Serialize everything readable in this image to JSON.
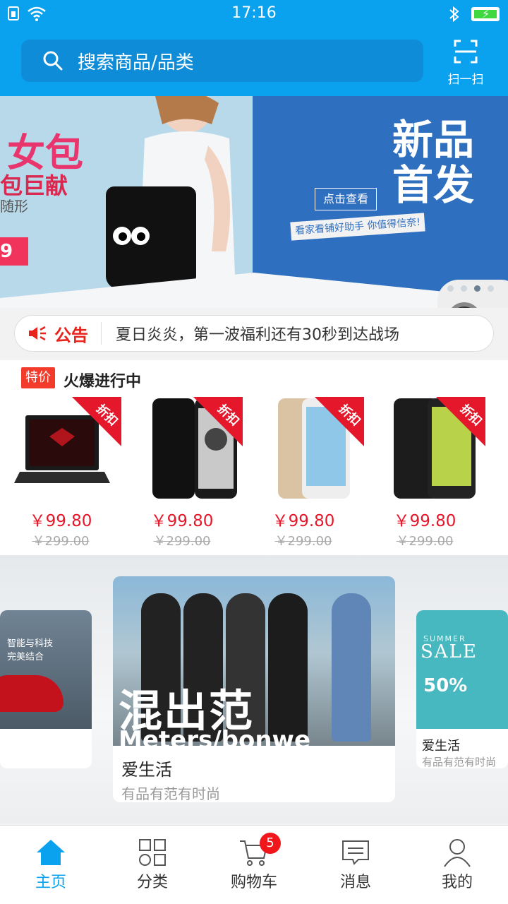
{
  "status_bar": {
    "time": "17:16"
  },
  "header": {
    "search_placeholder": "搜索商品/品类",
    "scan_label": "扫一扫"
  },
  "banner": {
    "left_title": "女包",
    "left_subtitle": "包巨献",
    "left_small": "随形",
    "left_price": "9",
    "view_button": "点击查看",
    "slogan": "看家看铺好助手 你值得信奈!",
    "right_title": "新品首发",
    "dots": 4,
    "active_dot": 3
  },
  "notice": {
    "title": "公告",
    "text": "夏日炎炎，第一波福利还有30秒到达战场"
  },
  "deals": {
    "tag": "特价",
    "title": "火爆进行中",
    "ribbon": "折扣",
    "products": [
      {
        "name": "laptop",
        "price": "￥99.80",
        "old_price": "￥299.00"
      },
      {
        "name": "samsung-phone",
        "price": "￥99.80",
        "old_price": "￥299.00"
      },
      {
        "name": "gold-phone",
        "price": "￥99.80",
        "old_price": "￥299.00"
      },
      {
        "name": "oppo-phone",
        "price": "￥99.80",
        "old_price": "￥299.00"
      }
    ]
  },
  "carousel": {
    "left_card_text": "智能与科技\n完美结合",
    "center": {
      "image_text": "混出范",
      "image_subtext": "Meters/bonwe",
      "title": "爱生活",
      "subtitle": "有品有范有时尚"
    },
    "right": {
      "image_small": "SUMMER",
      "image_text": "SALE",
      "image_50": "50%",
      "title": "爱生活",
      "subtitle": "有品有范有时尚"
    }
  },
  "tabbar": {
    "items": [
      {
        "label": "主页",
        "icon": "home-icon",
        "active": true
      },
      {
        "label": "分类",
        "icon": "grid-icon",
        "active": false
      },
      {
        "label": "购物车",
        "icon": "cart-icon",
        "active": false,
        "badge": "5"
      },
      {
        "label": "消息",
        "icon": "message-icon",
        "active": false
      },
      {
        "label": "我的",
        "icon": "user-icon",
        "active": false
      }
    ]
  },
  "colors": {
    "primary": "#0aa2ee",
    "accent_red": "#e5172a"
  }
}
